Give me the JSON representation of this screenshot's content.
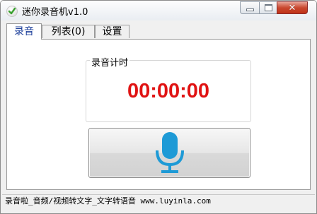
{
  "window": {
    "title": "迷你录音机v1.0",
    "app_icon": "check-badge-icon",
    "controls": {
      "minimize_icon": "minimize-icon",
      "maximize_icon": "maximize-icon",
      "close_icon": "close-icon",
      "close_label": "✕"
    }
  },
  "tabs": [
    {
      "label": "录音",
      "active": true
    },
    {
      "label": "列表(0)",
      "active": false
    },
    {
      "label": "设置",
      "active": false
    }
  ],
  "recording": {
    "timer_label": "录音计时",
    "timer_value": "00:00:00",
    "timer_color": "#e01313",
    "record_icon": "microphone-icon",
    "mic_color": "#1e9ad6"
  },
  "status_bar": {
    "text": "录音啦_音频/视频转文字_文字转语音 www.luyinla.com"
  }
}
